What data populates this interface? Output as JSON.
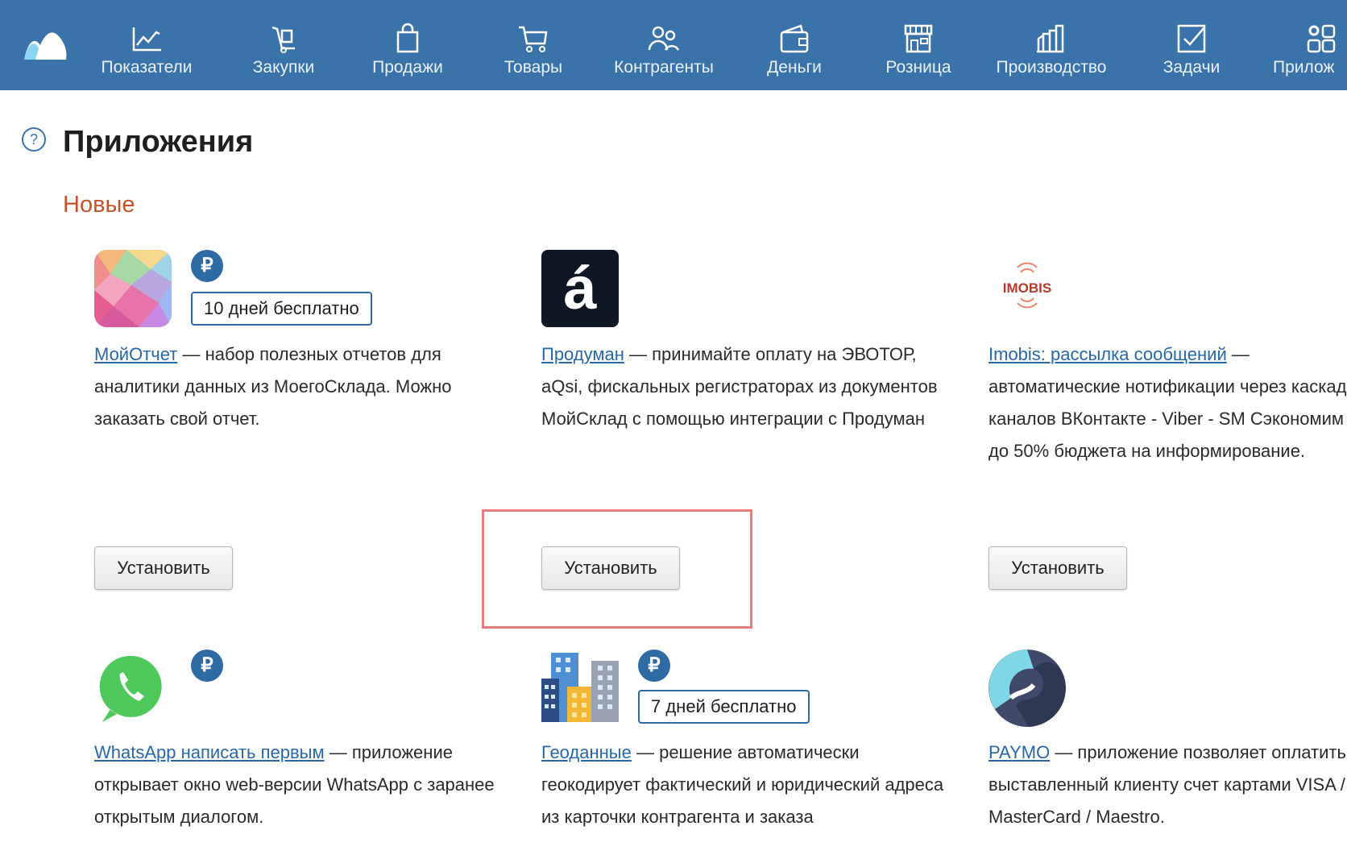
{
  "nav": {
    "items": [
      {
        "label": "Показатели",
        "icon": "chart-line-icon"
      },
      {
        "label": "Закупки",
        "icon": "dolly-icon"
      },
      {
        "label": "Продажи",
        "icon": "shopping-bag-icon"
      },
      {
        "label": "Товары",
        "icon": "cart-icon"
      },
      {
        "label": "Контрагенты",
        "icon": "people-icon"
      },
      {
        "label": "Деньги",
        "icon": "wallet-icon"
      },
      {
        "label": "Розница",
        "icon": "store-icon"
      },
      {
        "label": "Производство",
        "icon": "factory-icon"
      },
      {
        "label": "Задачи",
        "icon": "task-check-icon"
      },
      {
        "label": "Прилож",
        "icon": "apps-gear-icon"
      }
    ]
  },
  "page": {
    "help": "?",
    "title": "Приложения",
    "section": "Новые"
  },
  "apps": [
    {
      "name": "МойОтчет",
      "desc": " — набор полезных отчетов для аналитики данных из МоегоСклада. Можно заказать свой отчет.",
      "paid": "₽",
      "trial": "10 дней бесплатно",
      "install": "Установить"
    },
    {
      "name": "Продуман",
      "desc": " — принимайте оплату на ЭВОТОР, aQsi, фискальных регистраторах из документов МойСклад с помощью интеграции с Продуман",
      "install": "Установить",
      "icon_text": "á"
    },
    {
      "name": "Imobis: рассылка сообщений",
      "desc": " — автоматические нотификации через каскад каналов ВКонтакте - Viber - SM Сэкономим до 50% бюджета на информирование.",
      "install": "Установить",
      "icon_text": "IMOBIS"
    },
    {
      "name": "WhatsApp написать первым",
      "desc": " — приложение открывает окно web-версии WhatsApp с заранее открытым диалогом.",
      "paid": "₽"
    },
    {
      "name": "Геоданные",
      "desc": " — решение автоматически геокодирует фактический и юридический адреса из карточки контрагента и заказа",
      "paid": "₽",
      "trial": "7 дней бесплатно"
    },
    {
      "name": "PAYMO",
      "desc": " — приложение позволяет оплатить выставленный клиенту счет картами VISA / MasterCard / Maestro."
    }
  ],
  "colors": {
    "topbar": "#3a73a9",
    "link": "#2867a6",
    "section": "#c6522b",
    "highlight": "#e97b7b"
  }
}
